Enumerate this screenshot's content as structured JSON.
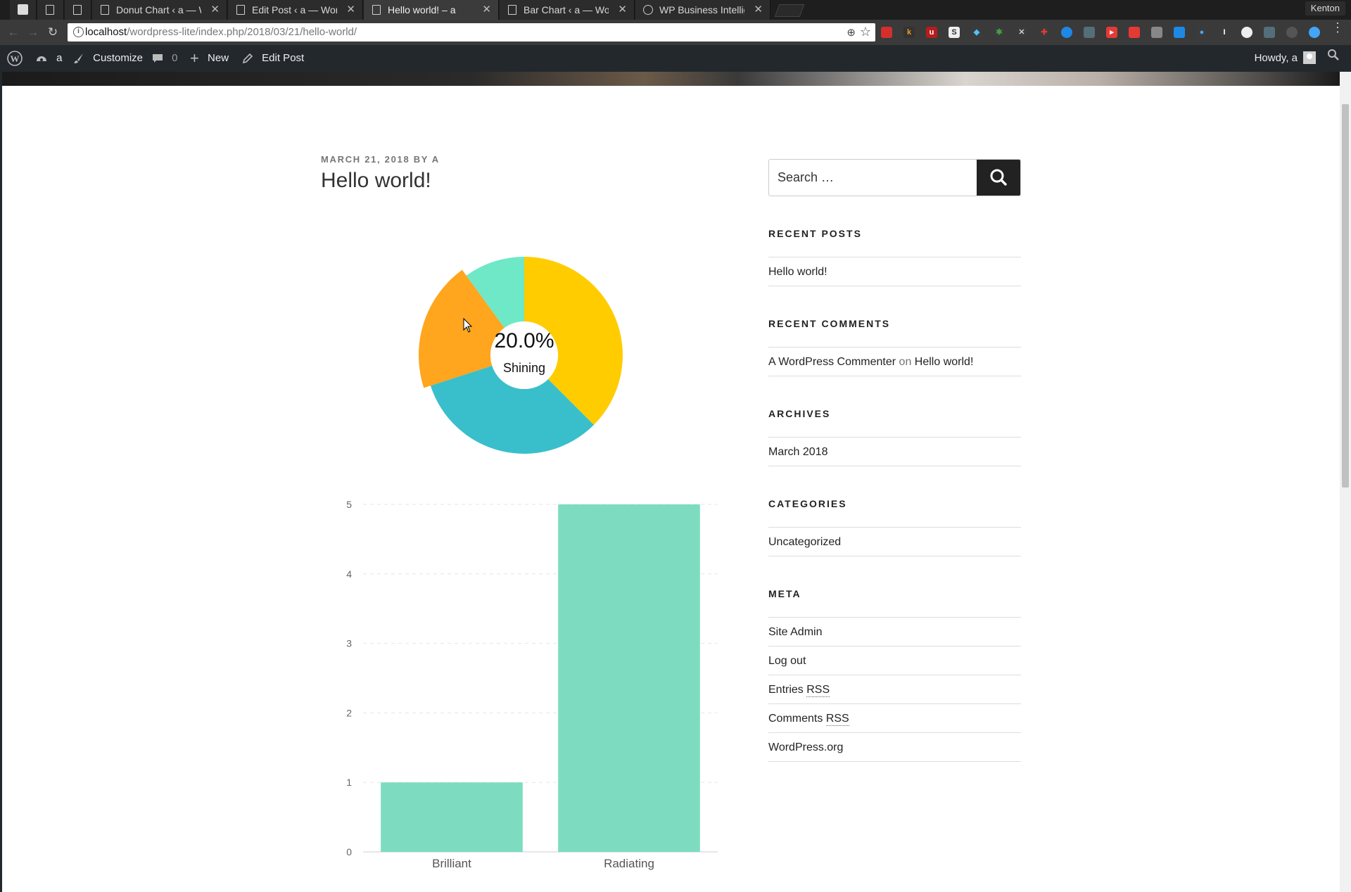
{
  "browser": {
    "tabs": [
      {
        "title": ""
      },
      {
        "title": ""
      },
      {
        "title": ""
      },
      {
        "title": "Donut Chart ‹ a — W"
      },
      {
        "title": "Edit Post ‹ a — Word"
      },
      {
        "title": "Hello world! – a"
      },
      {
        "title": "Bar Chart ‹ a — Wor"
      },
      {
        "title": "WP Business Intellig"
      }
    ],
    "profile_name": "Kenton",
    "url_host": "localhost",
    "url_path": "/wordpress-lite/index.php/2018/03/21/hello-world/"
  },
  "adminbar": {
    "site_name": "a",
    "customize": "Customize",
    "comments_count": "0",
    "new_label": "New",
    "edit_post": "Edit Post",
    "howdy": "Howdy, a"
  },
  "post": {
    "date": "March 21, 2018",
    "by": "by",
    "author": "a",
    "title": "Hello world!"
  },
  "donut_tooltip": {
    "value": "20.0%",
    "label": "Shining"
  },
  "chart_data": [
    {
      "type": "pie",
      "variant": "donut",
      "slices": [
        {
          "name": "",
          "value": 37.5,
          "color": "#ffcc00"
        },
        {
          "name": "",
          "value": 32.5,
          "color": "#39bfcb"
        },
        {
          "name": "Shining",
          "value": 20.0,
          "color": "#ffa51e",
          "highlighted": true
        },
        {
          "name": "",
          "value": 10.0,
          "color": "#6ee8c6"
        }
      ]
    },
    {
      "type": "bar",
      "categories": [
        "Brilliant",
        "Radiating"
      ],
      "values": [
        1,
        5
      ],
      "ylim": [
        0,
        5
      ],
      "yticks": [
        "0",
        "1",
        "2",
        "3",
        "4",
        "5"
      ],
      "color": "#7ddcc0",
      "grid": true
    }
  ],
  "sidebar": {
    "search_placeholder": "Search …",
    "recent_posts": {
      "title": "Recent Posts",
      "items": [
        "Hello world!"
      ]
    },
    "recent_comments": {
      "title": "Recent Comments",
      "author": "A WordPress Commenter",
      "on": "on",
      "post": "Hello world!"
    },
    "archives": {
      "title": "Archives",
      "items": [
        "March 2018"
      ]
    },
    "categories": {
      "title": "Categories",
      "items": [
        "Uncategorized"
      ]
    },
    "meta": {
      "title": "Meta",
      "site_admin": "Site Admin",
      "log_out": "Log out",
      "entries": "Entries",
      "comments": "Comments",
      "rss": "RSS",
      "wordpress_org": "WordPress.org"
    }
  }
}
